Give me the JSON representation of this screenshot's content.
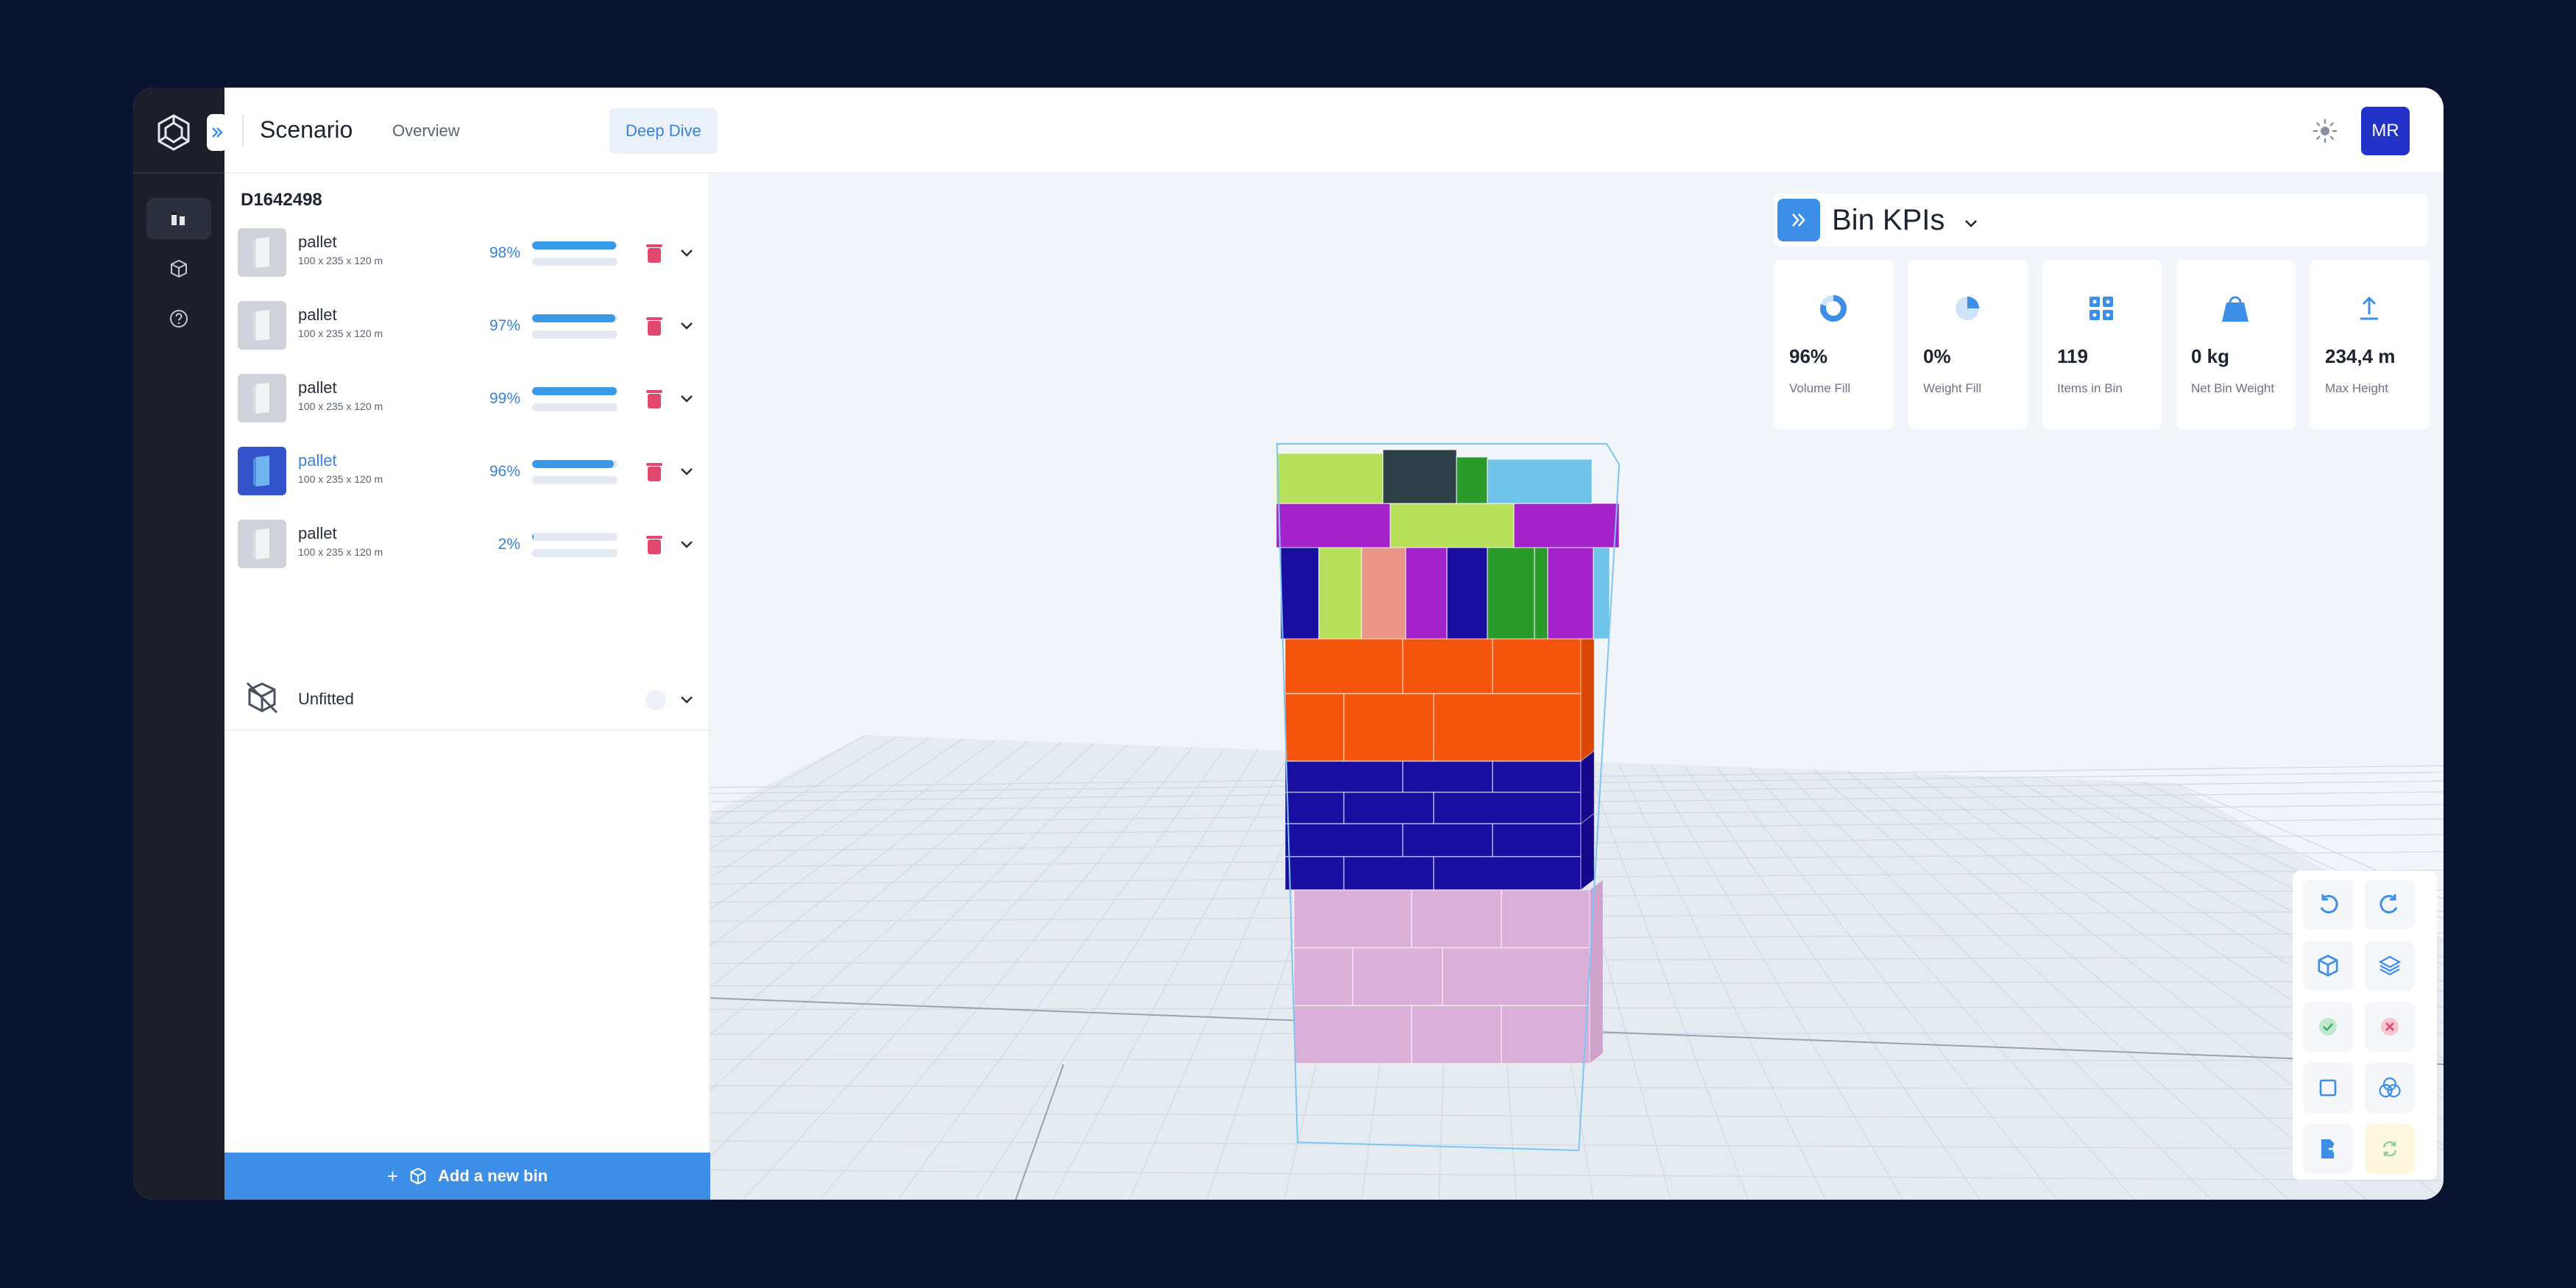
{
  "app": {
    "scenario_title": "Scenario",
    "tabs": [
      {
        "label": "Overview",
        "active": false
      },
      {
        "label": "Deep Dive",
        "active": true
      }
    ],
    "user_initials": "MR",
    "accent_color": "#3d8ee6"
  },
  "rail": {
    "items": [
      {
        "icon": "bins-icon",
        "active": true
      },
      {
        "icon": "cube-icon",
        "active": false
      },
      {
        "icon": "help-icon",
        "active": false
      }
    ]
  },
  "panel": {
    "title": "D1642498",
    "bins": [
      {
        "name": "pallet",
        "dims": "100 x 235 x 120 m",
        "pct_label": "98%",
        "fill": 0.98,
        "weight_fill": 0.0,
        "selected": false
      },
      {
        "name": "pallet",
        "dims": "100 x 235 x 120 m",
        "pct_label": "97%",
        "fill": 0.97,
        "weight_fill": 0.0,
        "selected": false
      },
      {
        "name": "pallet",
        "dims": "100 x 235 x 120 m",
        "pct_label": "99%",
        "fill": 0.99,
        "weight_fill": 0.0,
        "selected": false
      },
      {
        "name": "pallet",
        "dims": "100 x 235 x 120 m",
        "pct_label": "96%",
        "fill": 0.96,
        "weight_fill": 0.0,
        "selected": true
      },
      {
        "name": "pallet",
        "dims": "100 x 235 x 120 m",
        "pct_label": "2%",
        "fill": 0.02,
        "weight_fill": 0.0,
        "selected": false
      }
    ],
    "unfitted_label": "Unfitted",
    "add_bin_label": "Add a new bin"
  },
  "kpis": {
    "title": "Bin KPIs",
    "cards": [
      {
        "icon": "donut-icon",
        "value": "96%",
        "label": "Volume Fill"
      },
      {
        "icon": "pie-icon",
        "value": "0%",
        "label": "Weight Fill"
      },
      {
        "icon": "grid-icon",
        "value": "119",
        "label": "Items in Bin"
      },
      {
        "icon": "weight-icon",
        "value": "0 kg",
        "label": "Net Bin Weight"
      },
      {
        "icon": "upload-arrow-icon",
        "value": "234,4 m",
        "label": "Max Height"
      }
    ]
  },
  "toolbar": {
    "buttons": [
      "undo-icon",
      "redo-icon",
      "box-view-icon",
      "layers-icon",
      "check-icon",
      "close-icon",
      "square-icon",
      "overlap-icon",
      "export-icon",
      "refresh-icon"
    ]
  }
}
